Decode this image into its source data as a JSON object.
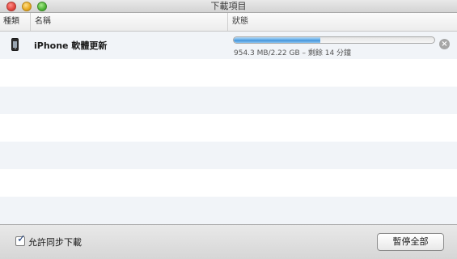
{
  "window": {
    "title": "下載項目"
  },
  "columns": {
    "kind": "種類",
    "name": "名稱",
    "status": "狀態"
  },
  "downloads": [
    {
      "icon": "iphone-icon",
      "name": "iPhone 軟體更新",
      "progress": 0.43,
      "detail": "954.3 MB/2.22 GB – 剩餘 14 分鐘"
    }
  ],
  "footer": {
    "allow_simultaneous_label": "允許同步下載",
    "allow_simultaneous_checked": true,
    "pause_all_label": "暫停全部"
  },
  "colors": {
    "progress_blue": "#5aa8e8",
    "row_alt": "#f1f4f8"
  }
}
